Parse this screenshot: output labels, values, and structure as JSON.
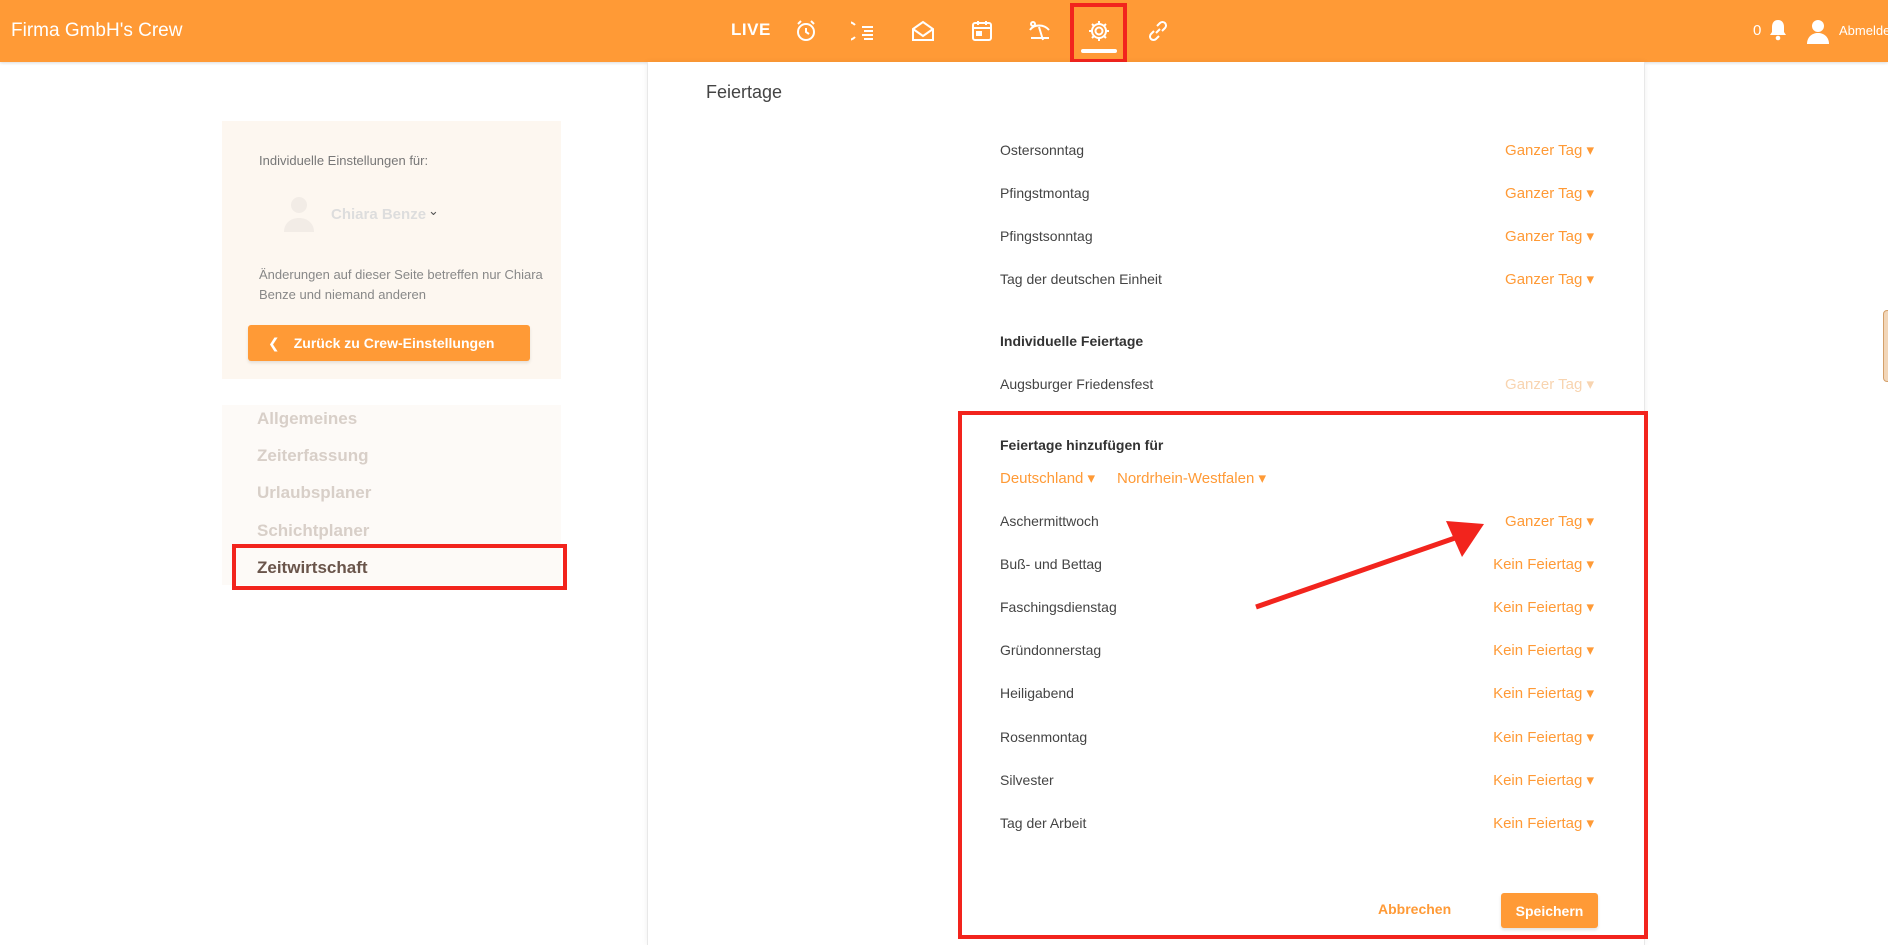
{
  "header": {
    "brand": "Firma GmbH's Crew",
    "live_label": "LIVE",
    "nav_icons": [
      "alarm-clock-icon",
      "timeline-icon",
      "envelope-icon",
      "calendar-icon",
      "vacation-icon",
      "settings-icon",
      "link-icon"
    ],
    "active_icon": "settings-icon",
    "notification_count": "0",
    "logout_label": "Abmelden"
  },
  "user_panel": {
    "label": "Individuelle Einstellungen für:",
    "user_name": "Chiara Benze",
    "note": "Änderungen auf dieser Seite betreffen nur Chiara Benze und niemand anderen",
    "back_button": "Zurück zu Crew-Einstellungen"
  },
  "sidebar": {
    "items": [
      {
        "label": "Allgemeines"
      },
      {
        "label": "Zeiterfassung"
      },
      {
        "label": "Urlaubsplaner"
      },
      {
        "label": "Schichtplaner"
      },
      {
        "label": "Zeitwirtschaft"
      }
    ],
    "active": "Zeitwirtschaft"
  },
  "main": {
    "section_title": "Feiertage",
    "holidays": [
      {
        "name": "Ostersonntag",
        "value": "Ganzer Tag ▾"
      },
      {
        "name": "Pfingstmontag",
        "value": "Ganzer Tag ▾"
      },
      {
        "name": "Pfingstsonntag",
        "value": "Ganzer Tag ▾"
      },
      {
        "name": "Tag der deutschen Einheit",
        "value": "Ganzer Tag ▾"
      }
    ],
    "individual_heading": "Individuelle Feiertage",
    "individual_holidays": [
      {
        "name": "Augsburger Friedensfest",
        "value": "Ganzer Tag ▾"
      }
    ],
    "add_heading": "Feiertage hinzufügen für",
    "country_select": "Deutschland ▾",
    "state_select": "Nordrhein-Westfalen ▾",
    "add_holidays": [
      {
        "name": "Aschermittwoch",
        "value": "Ganzer Tag ▾"
      },
      {
        "name": "Buß- und Bettag",
        "value": "Kein Feiertag ▾"
      },
      {
        "name": "Faschingsdienstag",
        "value": "Kein Feiertag ▾"
      },
      {
        "name": "Gründonnerstag",
        "value": "Kein Feiertag ▾"
      },
      {
        "name": "Heiligabend",
        "value": "Kein Feiertag ▾"
      },
      {
        "name": "Rosenmontag",
        "value": "Kein Feiertag ▾"
      },
      {
        "name": "Silvester",
        "value": "Kein Feiertag ▾"
      },
      {
        "name": "Tag der Arbeit",
        "value": "Kein Feiertag ▾"
      }
    ],
    "cancel_label": "Abbrechen",
    "save_label": "Speichern"
  },
  "colors": {
    "brand": "#ff9a36",
    "highlight": "#f2241d"
  }
}
